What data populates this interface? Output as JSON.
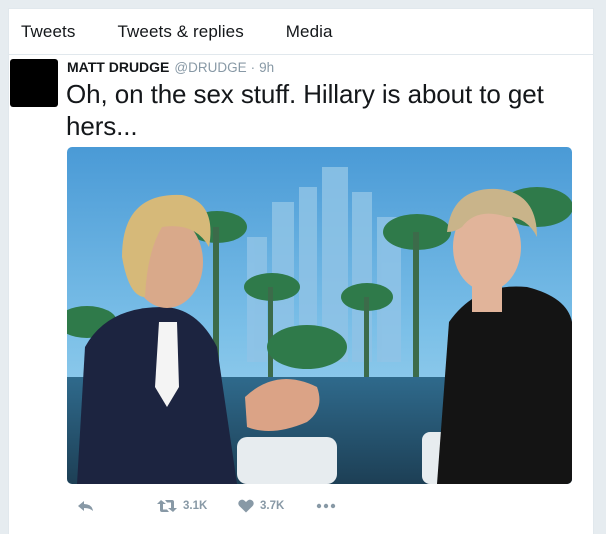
{
  "tabs": [
    {
      "label": "Tweets"
    },
    {
      "label": "Tweets & replies"
    },
    {
      "label": "Media"
    }
  ],
  "tweet": {
    "author_name": "MATT DRUDGE",
    "handle": "@DRUDGE",
    "separator": "·",
    "time": "9h",
    "text": "Oh, on the sex stuff. Hillary is about to get hers...",
    "retweet_count": "3.1K",
    "like_count": "3.7K"
  },
  "icons": [
    "reply-icon",
    "retweet-icon",
    "heart-icon",
    "more-icon"
  ],
  "colors": {
    "background": "#e6ecf0",
    "card": "#ffffff",
    "text": "#14171a",
    "secondary": "#8899a6"
  }
}
